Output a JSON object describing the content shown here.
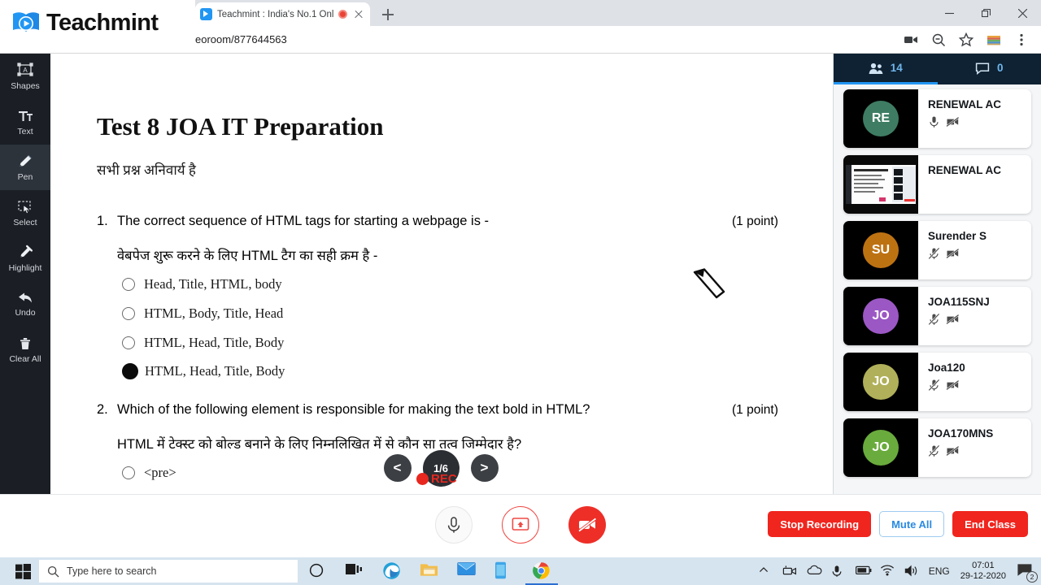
{
  "browser": {
    "tab": {
      "title": "Teachmint : India's No.1 Onl",
      "favicon": "teachmint-favicon",
      "recording_indicator": "recording-dot"
    },
    "new_tab_label": "+",
    "url_text": "eoroom/877644563",
    "toolbar_icons": [
      "media-cast-icon",
      "zoom-out-icon",
      "bookmark-star-icon",
      "extension-icon",
      "chrome-menu-icon"
    ],
    "window_controls": [
      "minimize-icon",
      "restore-icon",
      "close-icon"
    ]
  },
  "brand": {
    "name": "Teachmint"
  },
  "toolbar": {
    "tools": [
      {
        "label": "Shapes",
        "icon": "shapes-icon",
        "active": false
      },
      {
        "label": "Text",
        "icon": "text-icon",
        "active": false
      },
      {
        "label": "Pen",
        "icon": "pen-icon",
        "active": true
      },
      {
        "label": "Select",
        "icon": "select-icon",
        "active": false
      },
      {
        "label": "Highlight",
        "icon": "highlight-icon",
        "active": false
      },
      {
        "label": "Undo",
        "icon": "undo-icon",
        "active": false
      },
      {
        "label": "Clear All",
        "icon": "trash-icon",
        "active": false
      }
    ]
  },
  "board": {
    "title": "Test 8 JOA IT Preparation",
    "subtitle": "सभी प्रश्न अनिवार्य है",
    "questions": [
      {
        "number": "1.",
        "text_en": "The correct sequence of HTML tags for starting a webpage is -",
        "text_hi": "वेबपेज शुरू करने के लिए HTML टैग का सही क्रम है -",
        "points": "(1 point)",
        "options": [
          {
            "label": "Head, Title, HTML, body",
            "marked": false
          },
          {
            "label": "HTML, Body, Title, Head",
            "marked": false
          },
          {
            "label": "HTML, Head, Title, Body",
            "marked": false
          },
          {
            "label": "HTML, Head, Title, Body",
            "marked": true
          }
        ]
      },
      {
        "number": "2.",
        "text_en": "Which of the following element is responsible for making the text bold in HTML?",
        "text_hi": "HTML में टेक्स्ट को बोल्ड बनाने के लिए निम्नलिखित में से कौन सा तत्व जिम्मेदार है?",
        "points": "(1 point)",
        "options": [
          {
            "label": "<pre>",
            "marked": false
          }
        ]
      }
    ],
    "pager": {
      "prev": "<",
      "next": ">",
      "indicator": "1/6"
    },
    "rec_label": "REC"
  },
  "panel": {
    "tabs": [
      {
        "name": "participants",
        "icon": "people-icon",
        "count": "14",
        "active": true
      },
      {
        "name": "chat",
        "icon": "chat-icon",
        "count": "0",
        "active": false
      }
    ],
    "participants": [
      {
        "name": "RENEWAL AC",
        "initials": "RE",
        "color": "#3e7d63",
        "mic": "mic-on",
        "cam": "cam-off",
        "thumb": "avatar"
      },
      {
        "name": "RENEWAL AC",
        "initials": "RE",
        "color": "#3e7d63",
        "mic": "none",
        "cam": "none",
        "thumb": "screenshare"
      },
      {
        "name": "Surender S",
        "initials": "SU",
        "color": "#bd7212",
        "mic": "mic-off",
        "cam": "cam-off",
        "thumb": "avatar"
      },
      {
        "name": "JOA115SNJ",
        "initials": "JO",
        "color": "#9b58c4",
        "mic": "mic-off",
        "cam": "cam-off",
        "thumb": "avatar"
      },
      {
        "name": "Joa120",
        "initials": "JO",
        "color": "#b0b05a",
        "mic": "mic-off",
        "cam": "cam-off",
        "thumb": "avatar"
      },
      {
        "name": "JOA170MNS",
        "initials": "JO",
        "color": "#6aab3d",
        "mic": "mic-off",
        "cam": "cam-off",
        "thumb": "avatar"
      }
    ]
  },
  "controls": {
    "mic": {
      "name": "microphone-button",
      "icon": "mic-icon"
    },
    "share": {
      "name": "stop-screenshare-button",
      "icon": "screenshare-icon"
    },
    "camera": {
      "name": "camera-button",
      "icon": "camera-off-icon"
    },
    "stop_recording": "Stop Recording",
    "mute_all": "Mute All",
    "end_class": "End Class"
  },
  "taskbar": {
    "search_placeholder": "Type here to search",
    "apps": [
      "cortana-icon",
      "task-view-icon",
      "edge-icon",
      "file-explorer-icon",
      "mail-icon",
      "phone-icon",
      "chrome-icon"
    ],
    "tray_icons": [
      "show-hidden-icons-icon",
      "camera-tray-icon",
      "onedrive-icon",
      "microphone-tray-icon",
      "battery-icon",
      "wifi-icon",
      "volume-icon"
    ],
    "language": "ENG",
    "time": "07:01",
    "date": "29-12-2020",
    "notification_count": "2"
  },
  "colors": {
    "accent": "#2196f3",
    "danger": "#ed2f28",
    "panel_header": "#0e2233",
    "rail": "#1b1f25"
  }
}
